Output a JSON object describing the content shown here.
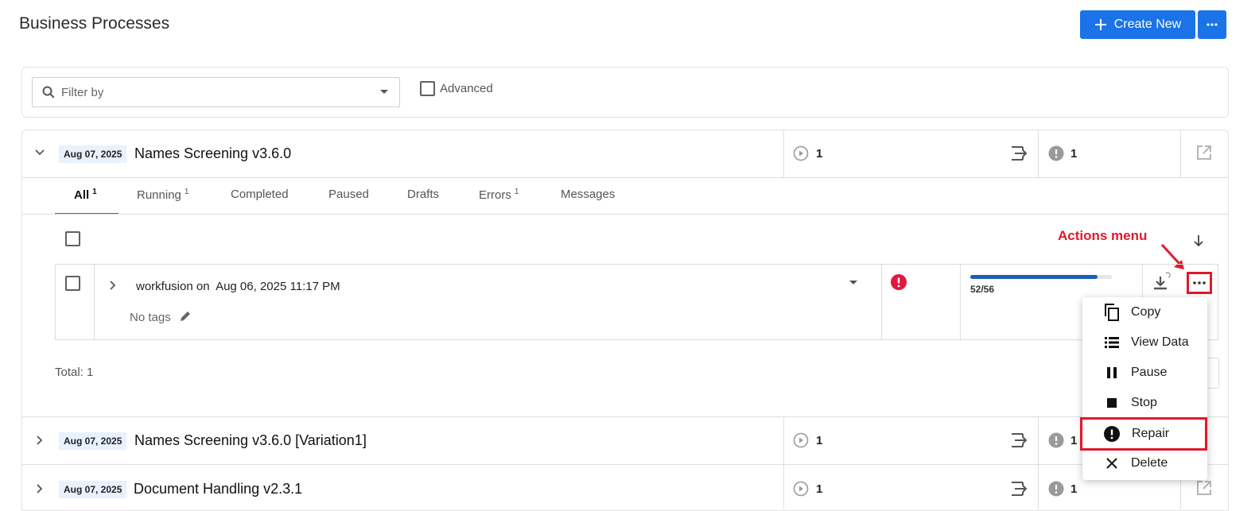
{
  "header": {
    "title": "Business Processes",
    "create_label": "Create New"
  },
  "filter": {
    "placeholder": "Filter by",
    "advanced_label": "Advanced"
  },
  "processes": [
    {
      "date": "Aug 07, 2025",
      "name": "Names Screening v3.6.0",
      "running": "1",
      "errors": "1",
      "expanded": true
    },
    {
      "date": "Aug 07, 2025",
      "name": "Names Screening v3.6.0 [Variation1]",
      "running": "1",
      "errors": "1",
      "expanded": false
    },
    {
      "date": "Aug 07, 2025",
      "name": "Document Handling v2.3.1",
      "running": "1",
      "errors": "1",
      "expanded": false
    }
  ],
  "tabs": [
    {
      "label": "All",
      "count": "1",
      "active": true
    },
    {
      "label": "Running",
      "count": "1"
    },
    {
      "label": "Completed",
      "count": ""
    },
    {
      "label": "Paused",
      "count": ""
    },
    {
      "label": "Drafts",
      "count": ""
    },
    {
      "label": "Errors",
      "count": "1"
    },
    {
      "label": "Messages",
      "count": ""
    }
  ],
  "instance": {
    "owner_prefix": "workfusion on",
    "timestamp": "Aug 06, 2025 11:17 PM",
    "tags_label": "No tags",
    "progress_text": "52/56",
    "progress_done": 52,
    "progress_total": 56
  },
  "total_label": "Total: 1",
  "annotation": {
    "label": "Actions menu",
    "color": "#e0192b"
  },
  "actions_menu": [
    {
      "label": "Copy",
      "icon": "copy-icon"
    },
    {
      "label": "View Data",
      "icon": "list-icon"
    },
    {
      "label": "Pause",
      "icon": "pause-icon"
    },
    {
      "label": "Stop",
      "icon": "stop-icon"
    },
    {
      "label": "Repair",
      "icon": "alert-circle-icon",
      "highlighted": true
    },
    {
      "label": "Delete",
      "icon": "close-icon"
    }
  ],
  "colors": {
    "primary": "#1a73e8",
    "error": "#e0193e",
    "progress": "#1a5fb4",
    "badge_bg": "#e8f1fd"
  }
}
